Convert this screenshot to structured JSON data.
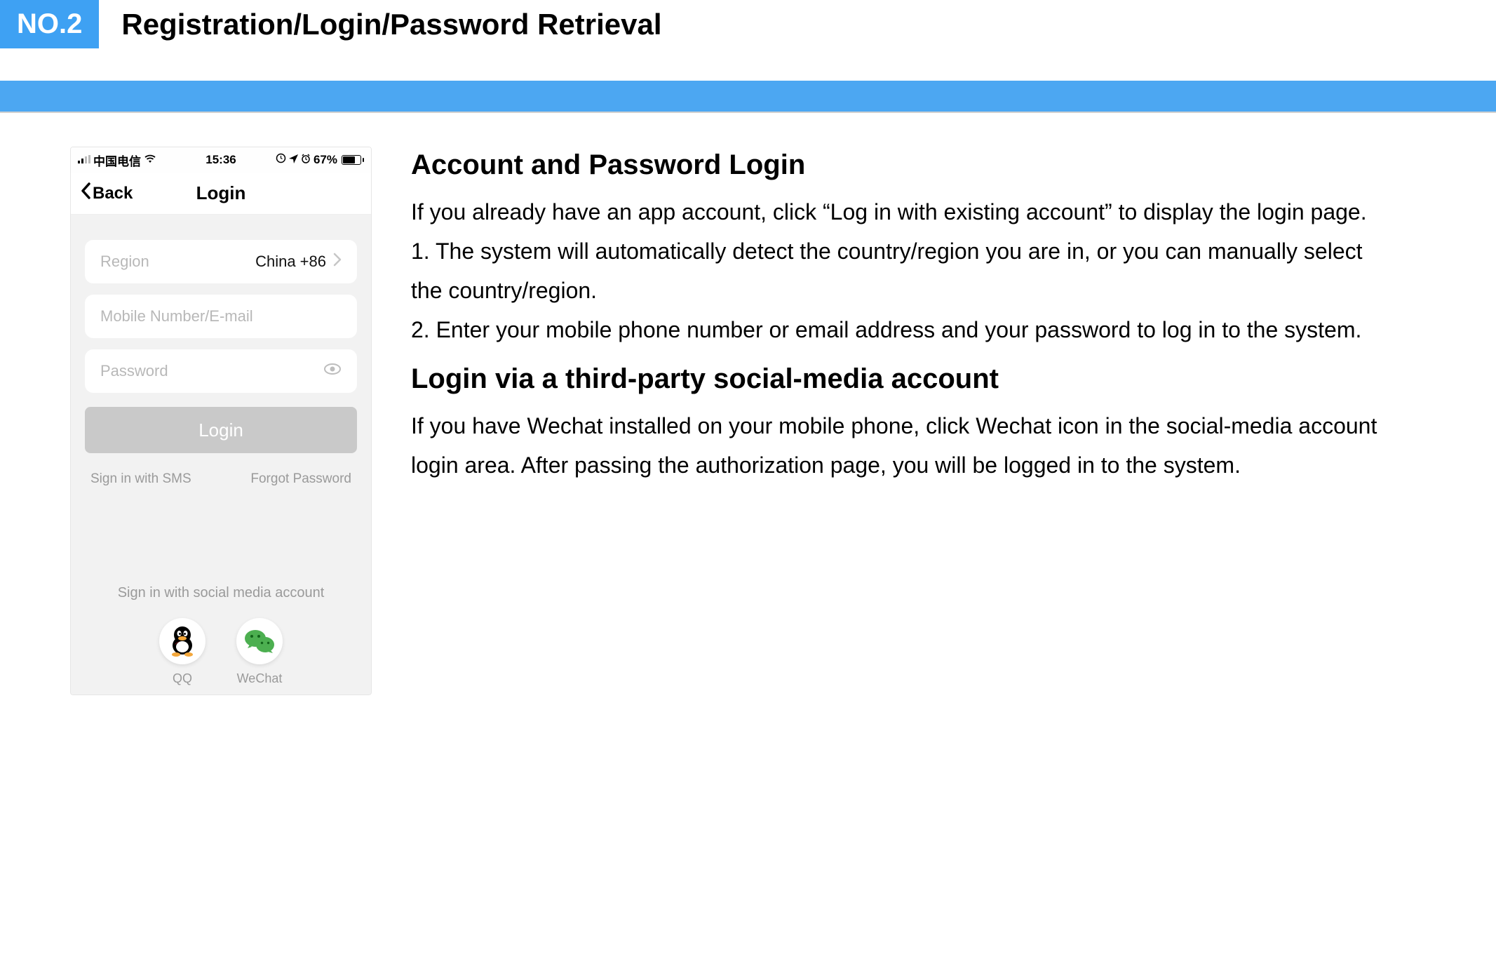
{
  "header": {
    "badge": "NO.2",
    "title": "Registration/Login/Password Retrieval"
  },
  "phone": {
    "statusBar": {
      "carrier": "中国电信",
      "time": "15:36",
      "battery": "67%"
    },
    "nav": {
      "back": "Back",
      "title": "Login"
    },
    "form": {
      "regionLabel": "Region",
      "regionValue": "China +86",
      "accountPlaceholder": "Mobile Number/E-mail",
      "passwordPlaceholder": "Password",
      "loginButton": "Login",
      "smsLink": "Sign in with SMS",
      "forgotLink": "Forgot Password"
    },
    "social": {
      "title": "Sign in with social media account",
      "qq": "QQ",
      "wechat": "WeChat"
    }
  },
  "desc": {
    "h1": "Account and Password Login",
    "p1": "If you already have an app account, click “Log in with existing account” to display the login page.",
    "p2": "1. The system will automatically detect the country/region you are in, or you can manually select the country/region.",
    "p3": "2. Enter your mobile phone number or email address and your password to log in to the system.",
    "h2": "Login via a third-party social-media account",
    "p4": "If you have Wechat installed on your mobile phone, click Wechat icon in the social-media account login area. After passing the authorization page, you will be logged in to the system."
  }
}
